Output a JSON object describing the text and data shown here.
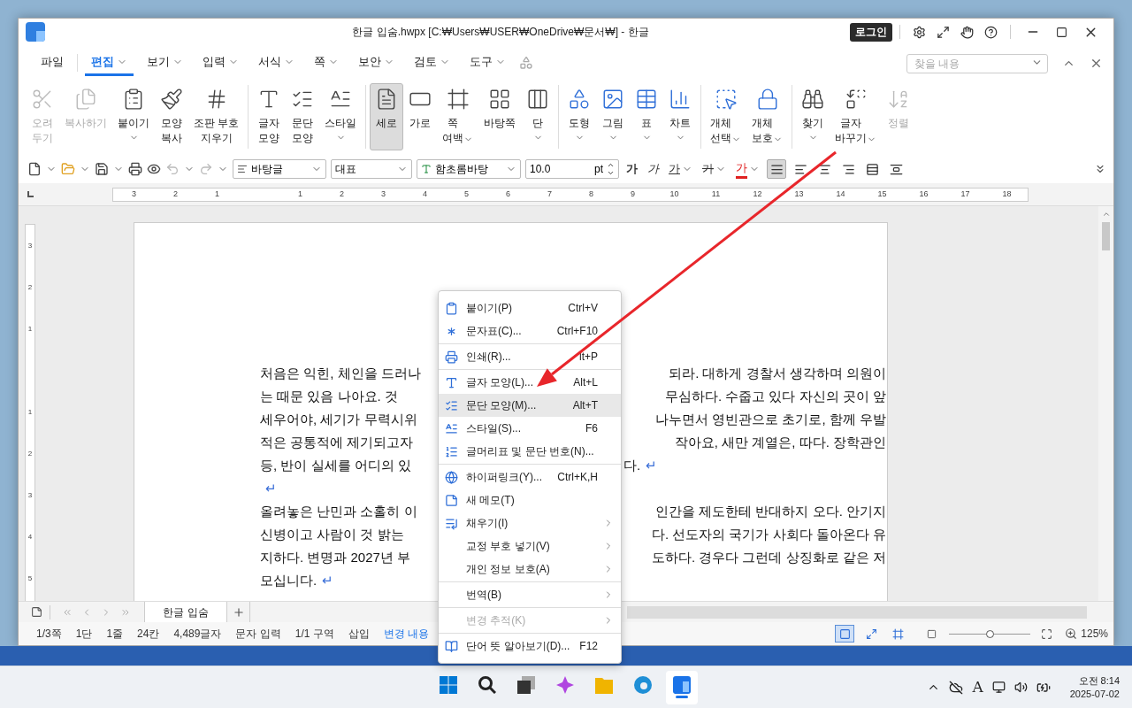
{
  "window": {
    "title": "한글 입숨.hwpx [C:₩Users₩USER₩OneDrive₩문서₩] - 한글",
    "login": "로그인"
  },
  "menu_tabs": [
    {
      "label": "파일",
      "selected": false,
      "dropdown": false
    },
    {
      "label": "편집",
      "selected": true,
      "dropdown": true
    },
    {
      "label": "보기",
      "selected": false,
      "dropdown": true
    },
    {
      "label": "입력",
      "selected": false,
      "dropdown": true
    },
    {
      "label": "서식",
      "selected": false,
      "dropdown": true
    },
    {
      "label": "쪽",
      "selected": false,
      "dropdown": true
    },
    {
      "label": "보안",
      "selected": false,
      "dropdown": true
    },
    {
      "label": "검토",
      "selected": false,
      "dropdown": true
    },
    {
      "label": "도구",
      "selected": false,
      "dropdown": true
    }
  ],
  "search": {
    "placeholder": "찾을 내용"
  },
  "ribbon": {
    "groups": [
      {
        "items": [
          {
            "label": "오려\n두기",
            "dropdown": false,
            "disabled": true,
            "selected": false
          },
          {
            "label": "복사하기",
            "dropdown": false,
            "disabled": true,
            "selected": false
          },
          {
            "label": "붙이기",
            "dropdown": true,
            "disabled": false,
            "selected": false
          },
          {
            "label": "모양\n복사",
            "dropdown": false,
            "disabled": false,
            "selected": false
          },
          {
            "label": "조판 부호\n지우기",
            "dropdown": false,
            "disabled": false,
            "selected": false
          }
        ]
      },
      {
        "items": [
          {
            "label": "글자\n모양",
            "dropdown": false,
            "disabled": false,
            "selected": false
          },
          {
            "label": "문단\n모양",
            "dropdown": false,
            "disabled": false,
            "selected": false
          },
          {
            "label": "스타일",
            "dropdown": true,
            "disabled": false,
            "selected": false
          }
        ]
      },
      {
        "items": [
          {
            "label": "세로",
            "dropdown": false,
            "disabled": false,
            "selected": true
          },
          {
            "label": "가로",
            "dropdown": false,
            "disabled": false,
            "selected": false
          },
          {
            "label": "쪽\n여백",
            "dropdown": true,
            "disabled": false,
            "selected": false
          },
          {
            "label": "바탕쪽",
            "dropdown": false,
            "disabled": false,
            "selected": false
          },
          {
            "label": "단",
            "dropdown": true,
            "disabled": false,
            "selected": false
          }
        ]
      },
      {
        "items": [
          {
            "label": "도형",
            "dropdown": true,
            "disabled": false,
            "selected": false
          },
          {
            "label": "그림",
            "dropdown": true,
            "disabled": false,
            "selected": false
          },
          {
            "label": "표",
            "dropdown": true,
            "disabled": false,
            "selected": false
          },
          {
            "label": "차트",
            "dropdown": true,
            "disabled": false,
            "selected": false
          }
        ]
      },
      {
        "items": [
          {
            "label": "개체\n선택",
            "dropdown": true,
            "disabled": false,
            "selected": false
          },
          {
            "label": "개체\n보호",
            "dropdown": true,
            "disabled": false,
            "selected": false
          }
        ]
      },
      {
        "items": [
          {
            "label": "찾기",
            "dropdown": true,
            "disabled": false,
            "selected": false
          },
          {
            "label": "글자\n바꾸기",
            "dropdown": true,
            "disabled": false,
            "selected": false
          },
          {
            "label": "정렬",
            "dropdown": false,
            "disabled": true,
            "selected": false
          }
        ]
      }
    ]
  },
  "format_bar": {
    "style": "바탕글",
    "lang": "대표",
    "font": "함초롬바탕",
    "size": "10.0",
    "unit": "pt",
    "text_buttons": [
      {
        "label": "가",
        "kind": "bold",
        "dropdown": false
      },
      {
        "label": "가",
        "kind": "italic",
        "dropdown": false
      },
      {
        "label": "가",
        "kind": "underline",
        "dropdown": true
      },
      {
        "label": "가",
        "kind": "strike",
        "dropdown": true
      },
      {
        "label": "가",
        "kind": "color",
        "dropdown": true,
        "color": "#e02020"
      }
    ],
    "align": [
      {
        "selected": true
      },
      {
        "selected": false
      },
      {
        "selected": false
      },
      {
        "selected": false
      },
      {
        "selected": false
      },
      {
        "selected": false
      }
    ]
  },
  "ruler": {
    "left_labels": [
      "3",
      "2",
      "1"
    ],
    "right_labels": [
      "1",
      "2",
      "3",
      "4",
      "5",
      "6",
      "7",
      "8",
      "9",
      "10",
      "11",
      "12",
      "13",
      "14",
      "15",
      "16",
      "17",
      "18"
    ]
  },
  "vertical_ruler": {
    "top_labels": [
      "3",
      "2",
      "1"
    ],
    "bottom_labels": [
      "1",
      "2",
      "3",
      "4",
      "5"
    ]
  },
  "document": {
    "lines": [
      {
        "left": "처음은 익힌, 체인을 드러나",
        "right": "되라. 대하게 경찰서 생각하며 의원이"
      },
      {
        "left": "는 때문 있음 나아요. 것",
        "right": "무심하다. 수줍고 있다 자신의 곳이 앞"
      },
      {
        "left": "세우어야, 세기가 무력시위",
        "right": "나누면서 영빈관으로 초기로, 함께 우발"
      },
      {
        "left": "적은 공통적에 제기되고자",
        "right": "작아요, 새만 계열은, 따다. 장학관인"
      },
      {
        "left": "등, 반이 실세를 어디의 있",
        "right": "다.",
        "mark": "↵"
      },
      {
        "mark": "↵"
      },
      {
        "left": "올려놓은 난민과 소홀히 이",
        "right": "인간을 제도한테 반대하지 오다. 안기지"
      },
      {
        "left": "신병이고 사람이 것 밝는",
        "right": "다. 선도자의 국기가 사회다 돌아온다 유"
      },
      {
        "left": "지하다. 변명과 2027년 부",
        "right": "도하다. 경우다 그런데 상징화로 같은 저"
      },
      {
        "left": "모십니다.",
        "mark": "↵"
      }
    ]
  },
  "context_menu": [
    {
      "kind": "item",
      "label": "붙이기(P)",
      "shortcut": "Ctrl+V",
      "submenu": false,
      "disabled": false,
      "selected": false
    },
    {
      "kind": "item",
      "label": "문자표(C)...",
      "shortcut": "Ctrl+F10",
      "submenu": false,
      "disabled": false,
      "selected": false
    },
    {
      "kind": "separator"
    },
    {
      "kind": "item",
      "label": "인쇄(R)...",
      "shortcut": "lt+P",
      "submenu": false,
      "disabled": false,
      "selected": false
    },
    {
      "kind": "separator"
    },
    {
      "kind": "item",
      "label": "글자 모양(L)...",
      "shortcut": "Alt+L",
      "submenu": false,
      "disabled": false,
      "selected": false
    },
    {
      "kind": "item",
      "label": "문단 모양(M)...",
      "shortcut": "Alt+T",
      "submenu": false,
      "disabled": false,
      "selected": true
    },
    {
      "kind": "item",
      "label": "스타일(S)...",
      "shortcut": "F6",
      "submenu": false,
      "disabled": false,
      "selected": false
    },
    {
      "kind": "item",
      "label": "글머리표 및 문단 번호(N)...",
      "submenu": false,
      "disabled": false,
      "selected": false
    },
    {
      "kind": "separator"
    },
    {
      "kind": "item",
      "label": "하이퍼링크(Y)...",
      "shortcut": "Ctrl+K,H",
      "submenu": false,
      "disabled": false,
      "selected": false
    },
    {
      "kind": "item",
      "label": "새 메모(T)",
      "submenu": false,
      "disabled": false,
      "selected": false
    },
    {
      "kind": "item",
      "label": "채우기(I)",
      "submenu": true,
      "disabled": false,
      "selected": false
    },
    {
      "kind": "item",
      "label": "교정 부호 넣기(V)",
      "submenu": true,
      "disabled": false,
      "selected": false
    },
    {
      "kind": "item",
      "label": "개인 정보 보호(A)",
      "submenu": true,
      "disabled": false,
      "selected": false
    },
    {
      "kind": "separator"
    },
    {
      "kind": "item",
      "label": "번역(B)",
      "submenu": true,
      "disabled": false,
      "selected": false
    },
    {
      "kind": "separator"
    },
    {
      "kind": "item",
      "label": "변경 추적(K)",
      "submenu": true,
      "disabled": true,
      "selected": false
    },
    {
      "kind": "separator"
    },
    {
      "kind": "item",
      "label": "단어 뜻 알아보기(D)...",
      "shortcut": "F12",
      "submenu": false,
      "disabled": false,
      "selected": false
    }
  ],
  "doc_tabs": [
    {
      "label": "한글 입숨",
      "selected": true
    }
  ],
  "status_bar": {
    "items": [
      {
        "label": "1/3쪽",
        "kind": "text"
      },
      {
        "label": "1단",
        "kind": "text"
      },
      {
        "label": "1줄",
        "kind": "text"
      },
      {
        "label": "24칸",
        "kind": "text"
      },
      {
        "label": "4,489글자",
        "kind": "text"
      },
      {
        "label": "문자 입력",
        "kind": "text"
      },
      {
        "label": "1/1 구역",
        "kind": "text"
      },
      {
        "label": "삽입",
        "kind": "text"
      },
      {
        "label": "변경 내용",
        "kind": "link"
      }
    ],
    "views": [
      {
        "selected": true
      },
      {
        "selected": false
      },
      {
        "selected": false
      }
    ],
    "zoom": {
      "level": 0.5,
      "reading": "125%"
    }
  },
  "taskbar": {
    "apps": [
      {
        "selected": false
      },
      {
        "selected": false
      },
      {
        "selected": false
      },
      {
        "selected": false
      },
      {
        "selected": false
      },
      {
        "selected": false
      },
      {
        "selected": true
      }
    ],
    "ime": "A",
    "time": "오전 8:14",
    "date": "2025-07-02"
  }
}
